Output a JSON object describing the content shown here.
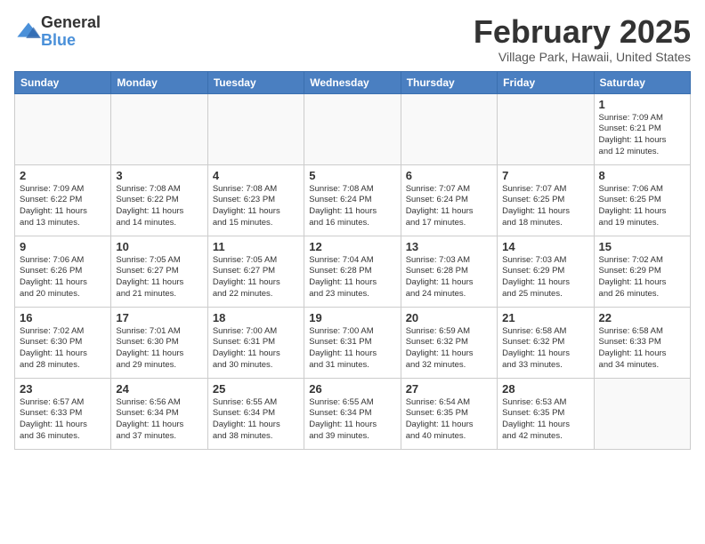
{
  "logo": {
    "general": "General",
    "blue": "Blue"
  },
  "header": {
    "month": "February 2025",
    "location": "Village Park, Hawaii, United States"
  },
  "days_of_week": [
    "Sunday",
    "Monday",
    "Tuesday",
    "Wednesday",
    "Thursday",
    "Friday",
    "Saturday"
  ],
  "weeks": [
    [
      {
        "day": "",
        "info": ""
      },
      {
        "day": "",
        "info": ""
      },
      {
        "day": "",
        "info": ""
      },
      {
        "day": "",
        "info": ""
      },
      {
        "day": "",
        "info": ""
      },
      {
        "day": "",
        "info": ""
      },
      {
        "day": "1",
        "info": "Sunrise: 7:09 AM\nSunset: 6:21 PM\nDaylight: 11 hours\nand 12 minutes."
      }
    ],
    [
      {
        "day": "2",
        "info": "Sunrise: 7:09 AM\nSunset: 6:22 PM\nDaylight: 11 hours\nand 13 minutes."
      },
      {
        "day": "3",
        "info": "Sunrise: 7:08 AM\nSunset: 6:22 PM\nDaylight: 11 hours\nand 14 minutes."
      },
      {
        "day": "4",
        "info": "Sunrise: 7:08 AM\nSunset: 6:23 PM\nDaylight: 11 hours\nand 15 minutes."
      },
      {
        "day": "5",
        "info": "Sunrise: 7:08 AM\nSunset: 6:24 PM\nDaylight: 11 hours\nand 16 minutes."
      },
      {
        "day": "6",
        "info": "Sunrise: 7:07 AM\nSunset: 6:24 PM\nDaylight: 11 hours\nand 17 minutes."
      },
      {
        "day": "7",
        "info": "Sunrise: 7:07 AM\nSunset: 6:25 PM\nDaylight: 11 hours\nand 18 minutes."
      },
      {
        "day": "8",
        "info": "Sunrise: 7:06 AM\nSunset: 6:25 PM\nDaylight: 11 hours\nand 19 minutes."
      }
    ],
    [
      {
        "day": "9",
        "info": "Sunrise: 7:06 AM\nSunset: 6:26 PM\nDaylight: 11 hours\nand 20 minutes."
      },
      {
        "day": "10",
        "info": "Sunrise: 7:05 AM\nSunset: 6:27 PM\nDaylight: 11 hours\nand 21 minutes."
      },
      {
        "day": "11",
        "info": "Sunrise: 7:05 AM\nSunset: 6:27 PM\nDaylight: 11 hours\nand 22 minutes."
      },
      {
        "day": "12",
        "info": "Sunrise: 7:04 AM\nSunset: 6:28 PM\nDaylight: 11 hours\nand 23 minutes."
      },
      {
        "day": "13",
        "info": "Sunrise: 7:03 AM\nSunset: 6:28 PM\nDaylight: 11 hours\nand 24 minutes."
      },
      {
        "day": "14",
        "info": "Sunrise: 7:03 AM\nSunset: 6:29 PM\nDaylight: 11 hours\nand 25 minutes."
      },
      {
        "day": "15",
        "info": "Sunrise: 7:02 AM\nSunset: 6:29 PM\nDaylight: 11 hours\nand 26 minutes."
      }
    ],
    [
      {
        "day": "16",
        "info": "Sunrise: 7:02 AM\nSunset: 6:30 PM\nDaylight: 11 hours\nand 28 minutes."
      },
      {
        "day": "17",
        "info": "Sunrise: 7:01 AM\nSunset: 6:30 PM\nDaylight: 11 hours\nand 29 minutes."
      },
      {
        "day": "18",
        "info": "Sunrise: 7:00 AM\nSunset: 6:31 PM\nDaylight: 11 hours\nand 30 minutes."
      },
      {
        "day": "19",
        "info": "Sunrise: 7:00 AM\nSunset: 6:31 PM\nDaylight: 11 hours\nand 31 minutes."
      },
      {
        "day": "20",
        "info": "Sunrise: 6:59 AM\nSunset: 6:32 PM\nDaylight: 11 hours\nand 32 minutes."
      },
      {
        "day": "21",
        "info": "Sunrise: 6:58 AM\nSunset: 6:32 PM\nDaylight: 11 hours\nand 33 minutes."
      },
      {
        "day": "22",
        "info": "Sunrise: 6:58 AM\nSunset: 6:33 PM\nDaylight: 11 hours\nand 34 minutes."
      }
    ],
    [
      {
        "day": "23",
        "info": "Sunrise: 6:57 AM\nSunset: 6:33 PM\nDaylight: 11 hours\nand 36 minutes."
      },
      {
        "day": "24",
        "info": "Sunrise: 6:56 AM\nSunset: 6:34 PM\nDaylight: 11 hours\nand 37 minutes."
      },
      {
        "day": "25",
        "info": "Sunrise: 6:55 AM\nSunset: 6:34 PM\nDaylight: 11 hours\nand 38 minutes."
      },
      {
        "day": "26",
        "info": "Sunrise: 6:55 AM\nSunset: 6:34 PM\nDaylight: 11 hours\nand 39 minutes."
      },
      {
        "day": "27",
        "info": "Sunrise: 6:54 AM\nSunset: 6:35 PM\nDaylight: 11 hours\nand 40 minutes."
      },
      {
        "day": "28",
        "info": "Sunrise: 6:53 AM\nSunset: 6:35 PM\nDaylight: 11 hours\nand 42 minutes."
      },
      {
        "day": "",
        "info": ""
      }
    ]
  ]
}
